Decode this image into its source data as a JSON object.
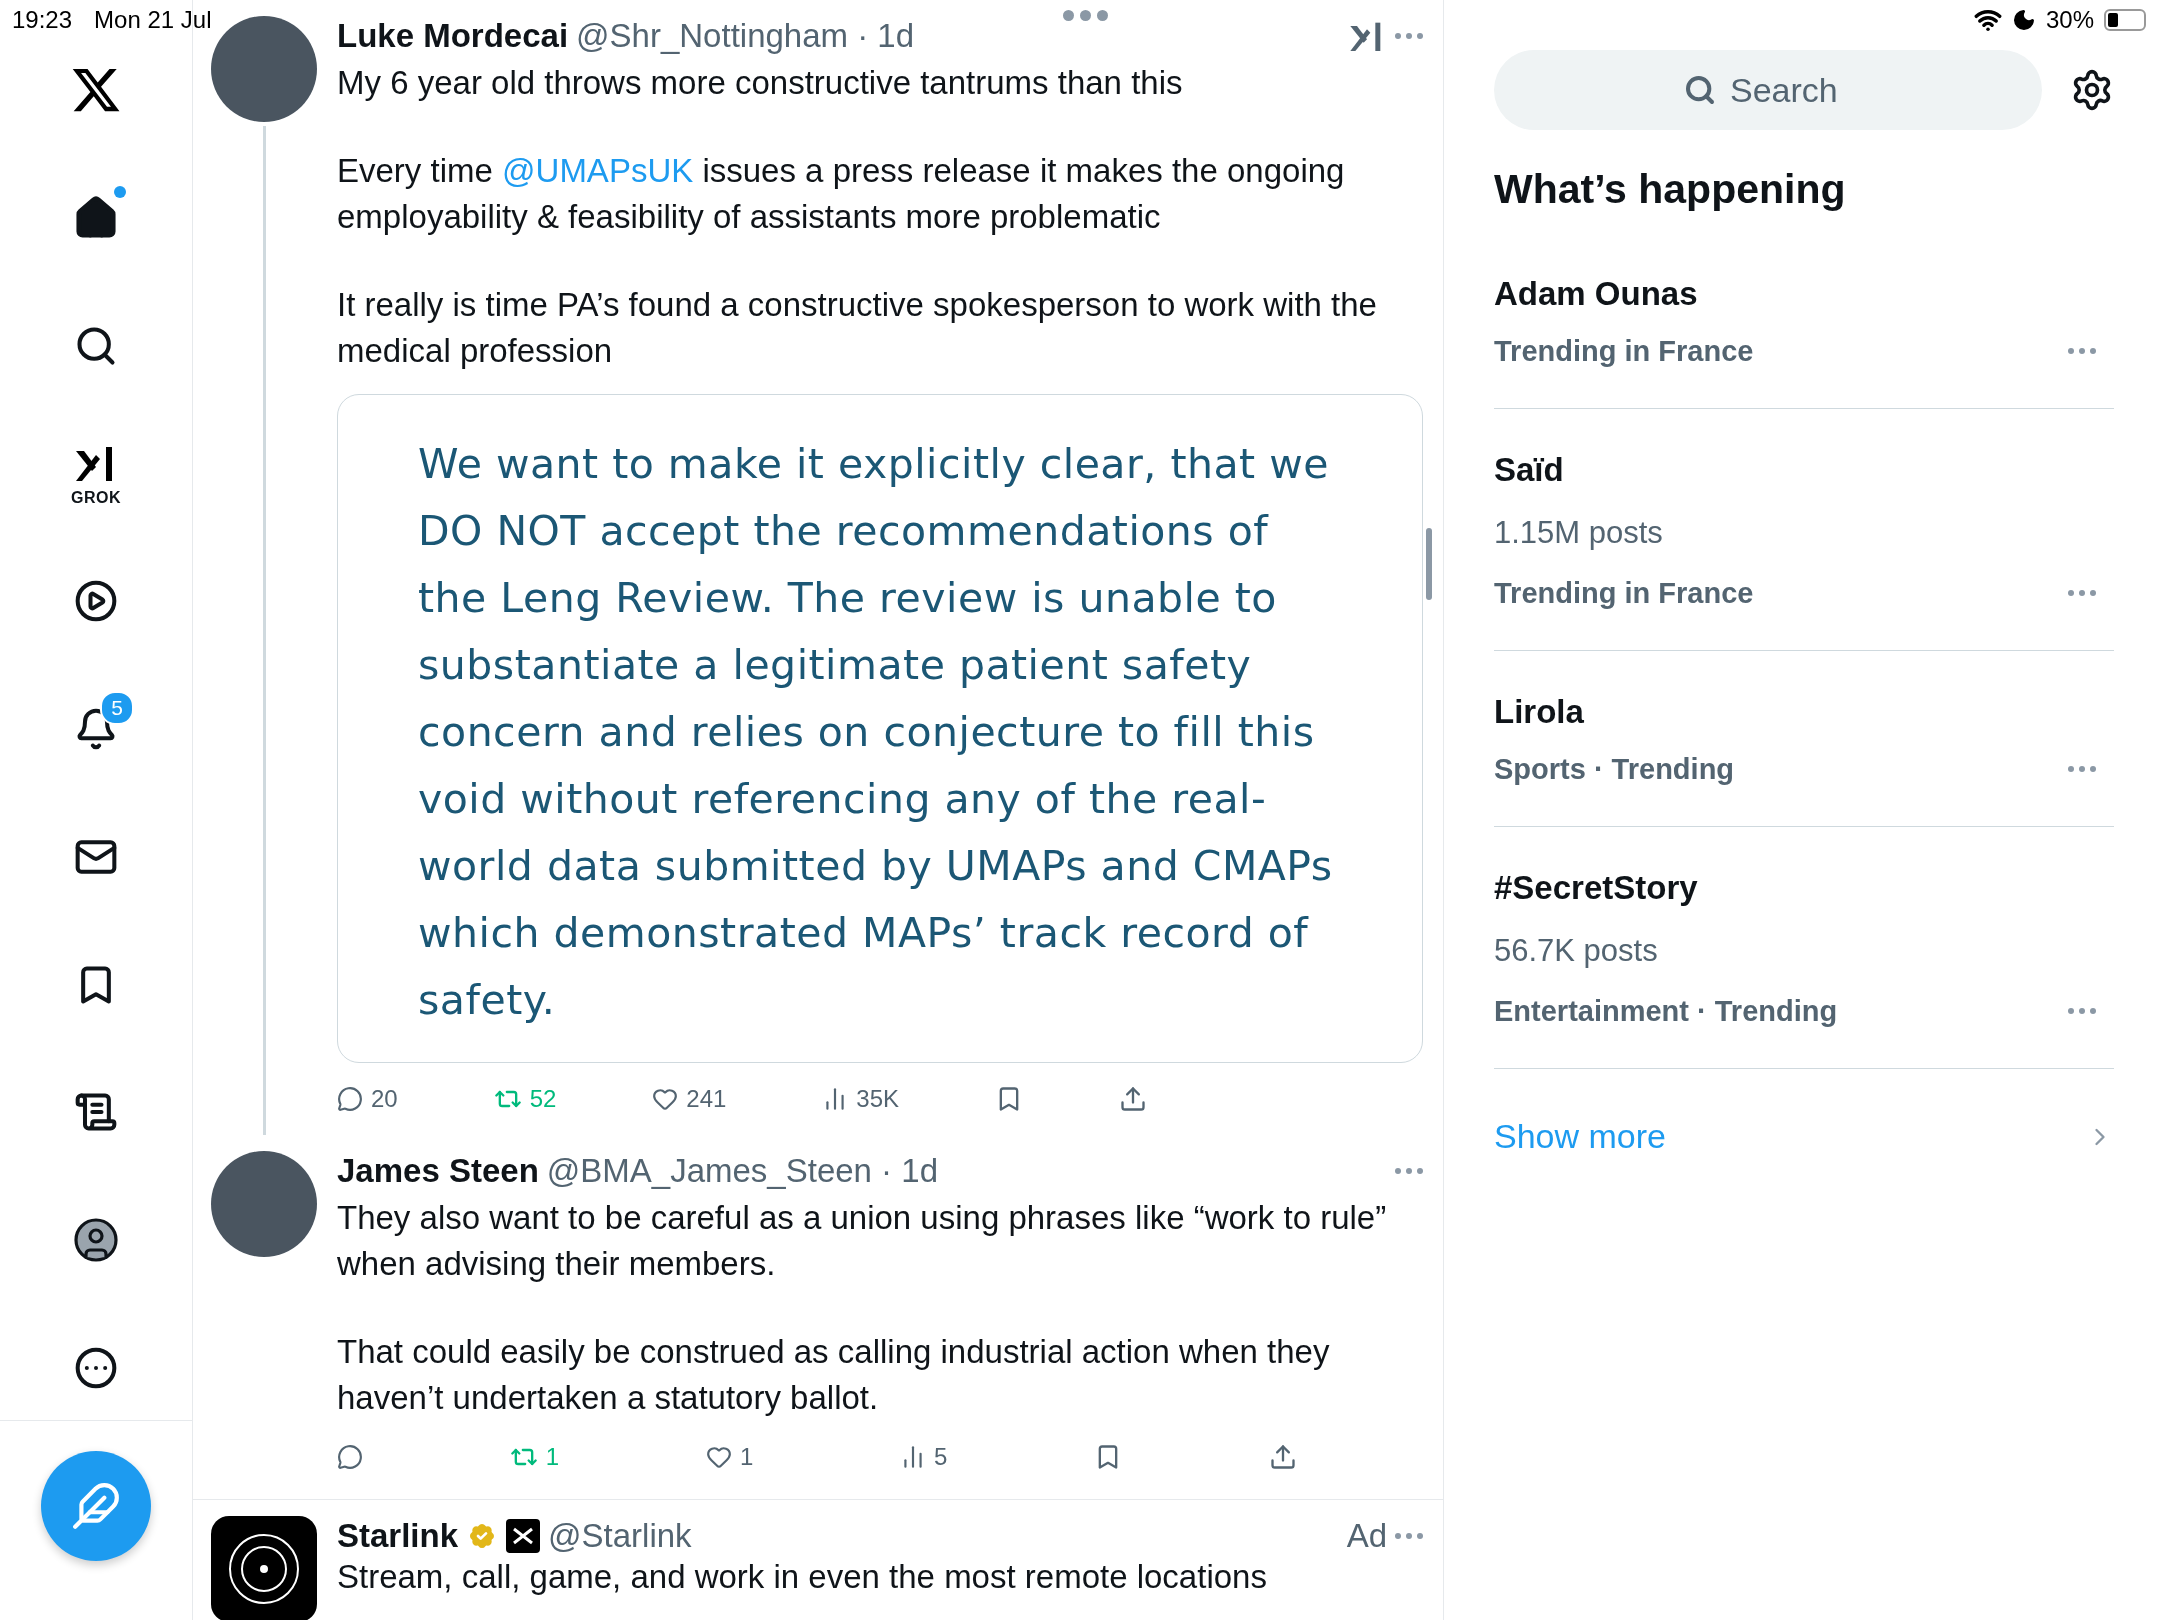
{
  "status_bar": {
    "time": "19:23",
    "date": "Mon 21 Jul",
    "battery": "30%"
  },
  "sidebar": {
    "items": [
      {
        "kind": "logo"
      },
      {
        "kind": "home",
        "selected": true,
        "unread": true
      },
      {
        "kind": "search",
        "selected": false
      },
      {
        "kind": "grok",
        "selected": false,
        "label": "GROK"
      },
      {
        "kind": "video",
        "selected": false
      },
      {
        "kind": "notifications",
        "selected": false,
        "badge": "5"
      },
      {
        "kind": "messages",
        "selected": false
      },
      {
        "kind": "bookmarks",
        "selected": false
      },
      {
        "kind": "lists",
        "selected": false
      },
      {
        "kind": "profile",
        "selected": false
      },
      {
        "kind": "more",
        "selected": false
      }
    ]
  },
  "posts": [
    {
      "kind": "post",
      "author": "Luke Mordecai",
      "handle": "@Shr_Nottingham · 1d",
      "thread_continues": true,
      "grok": true,
      "paragraphs": [
        [
          {
            "text": "My 6 year old throws more constructive tantrums than this"
          }
        ],
        [
          {
            "text": "Every time "
          },
          {
            "text": "@UMAPsUK",
            "kind": "mention"
          },
          {
            "text": " issues a press release it makes the ongoing employability & feasibility of assistants more problematic"
          }
        ],
        [
          {
            "text": "It really is time PA’s found a constructive spokesperson to work with the medical profession"
          }
        ]
      ],
      "quote": "We want to make it explicitly clear, that we DO NOT accept the recommendations of the Leng Review. The review is unable to substantiate a legitimate patient safety concern and relies on conjecture to fill this void without referencing any of the real-world data submitted by UMAPs and CMAPs which demonstrated MAPs’ track record of safety.",
      "actions": {
        "replies": "20",
        "reposts": "52",
        "likes": "241",
        "views": "35K"
      },
      "reposted": true
    },
    {
      "kind": "post",
      "author": "James Steen",
      "handle": "@BMA_James_Steen · 1d",
      "thread_continues": false,
      "grok": false,
      "paragraphs": [
        [
          {
            "text": "They also want to be careful as a union using phrases like “work to rule” when advising their members."
          }
        ],
        [
          {
            "text": "That could easily be construed as calling industrial action when they haven’t undertaken a statutory ballot."
          }
        ]
      ],
      "actions": {
        "reposts": "1",
        "likes": "1",
        "views": "5"
      },
      "reposted": true
    },
    {
      "kind": "ad",
      "author": "Starlink",
      "handle": "@Starlink",
      "verified": true,
      "label": "Ad",
      "paragraphs": [
        [
          {
            "text": "Stream, call, game, and work in even the most remote locations"
          }
        ]
      ]
    }
  ],
  "search": {
    "placeholder": "Search"
  },
  "trends_heading": "What’s happening",
  "trends": [
    {
      "title": "Adam Ounas",
      "context": "Trending in France"
    },
    {
      "title": "Saïd",
      "posts": "1.15M posts",
      "context": "Trending in France"
    },
    {
      "title": "Lirola",
      "context": "Sports · Trending"
    },
    {
      "title": "#SecretStory",
      "posts": "56.7K posts",
      "context": "Entertainment · Trending"
    }
  ],
  "show_more": "Show more"
}
